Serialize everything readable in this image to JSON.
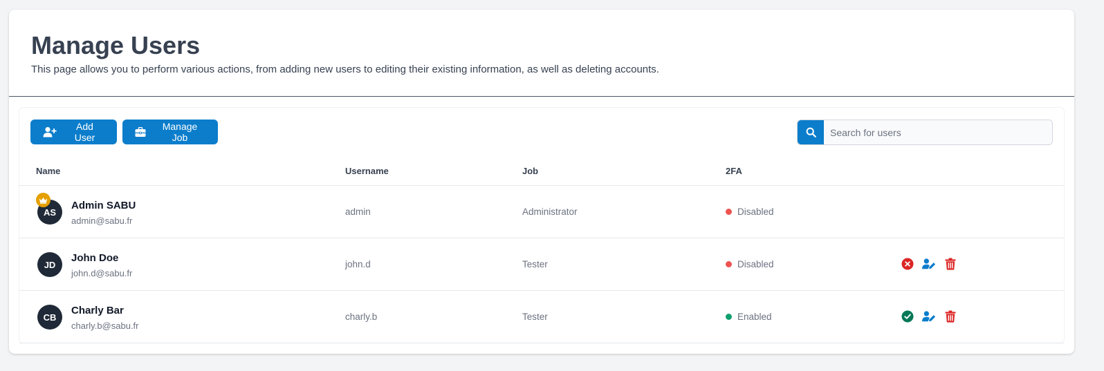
{
  "header": {
    "title": "Manage Users",
    "description": "This page allows you to perform various actions, from adding new users to editing their existing information, as well as deleting accounts."
  },
  "toolbar": {
    "add_user_label": "Add User",
    "manage_job_label": "Manage Job",
    "add_user_icon": "user-plus-icon",
    "manage_job_icon": "briefcase-icon"
  },
  "search": {
    "placeholder": "Search for users",
    "value": "",
    "icon": "search-icon"
  },
  "table": {
    "columns": [
      "Name",
      "Username",
      "Job",
      "2FA"
    ],
    "rows": [
      {
        "initials": "AS",
        "name": "Admin SABU",
        "email": "admin@sabu.fr",
        "username": "admin",
        "job": "Administrator",
        "tfa": "Disabled",
        "tfa_color": "#ef5350",
        "is_admin": true,
        "badge_icon": "crown-icon"
      },
      {
        "initials": "JD",
        "name": "John Doe",
        "email": "john.d@sabu.fr",
        "username": "john.d",
        "job": "Tester",
        "tfa": "Disabled",
        "tfa_color": "#ef5350",
        "actions": [
          "x-circle-icon",
          "user-edit-icon",
          "trash-icon"
        ]
      },
      {
        "initials": "CB",
        "name": "Charly Bar",
        "email": "charly.b@sabu.fr",
        "username": "charly.b",
        "job": "Tester",
        "tfa": "Enabled",
        "tfa_color": "#0e9f6e",
        "actions": [
          "check-circle-icon",
          "user-edit-icon",
          "trash-icon"
        ]
      }
    ]
  },
  "colors": {
    "accent": "#0b7dcb",
    "danger": "#dc2626",
    "success": "#047857",
    "avatar_bg": "#1f2937",
    "crown_badge": "#e5a000"
  }
}
